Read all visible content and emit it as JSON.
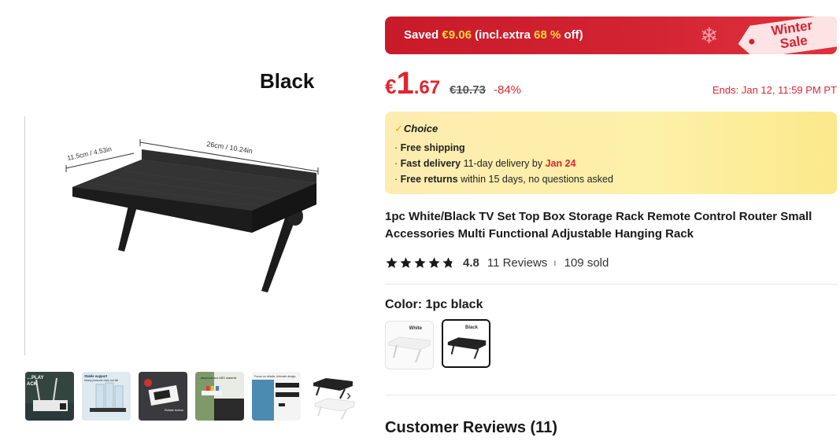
{
  "gallery": {
    "color_caption": "Black",
    "dimension_width": "26cm / 10.24in",
    "dimension_depth": "11.5cm / 4.53in",
    "next_icon": "chevron-right-icon",
    "next_glyph": "›",
    "thumbnails": [
      {
        "name": "thumb-display-rack",
        "lines": [
          "…PLAY",
          "ACK"
        ]
      },
      {
        "name": "thumb-bottles",
        "lines": [
          "Stable support",
          "Heavy pressure does not fall"
        ]
      },
      {
        "name": "thumb-router",
        "lines": [
          "Rotate button"
        ]
      },
      {
        "name": "thumb-scene",
        "lines": [
          "…aterproof and ABS material"
        ]
      },
      {
        "name": "thumb-install",
        "lines": [
          "Focus on details, Intimate design"
        ]
      },
      {
        "name": "thumb-variants",
        "lines": []
      }
    ]
  },
  "banner": {
    "saved_prefix": "Saved ",
    "saved_amount": "€9.06",
    "saved_middle": " (incl.extra ",
    "saved_percent": "68 %",
    "saved_suffix": " off)",
    "flake_icon": "snowflake-icon",
    "tag_line1": "Winter",
    "tag_line2": "Sale"
  },
  "price": {
    "currency": "€",
    "integer": "1",
    "decimal": ".67",
    "original": "€10.73",
    "discount": "-84%",
    "ends": "Ends: Jan 12, 11:59 PM PT"
  },
  "choice": {
    "check_glyph": "✓",
    "brand": "Choice",
    "bullet": "·",
    "free_shipping": "Free shipping",
    "fast_delivery_label": "Fast delivery",
    "fast_delivery_text": " 11-day delivery by ",
    "fast_delivery_date": "Jan 24",
    "free_returns_label": "Free returns",
    "free_returns_text": "  within 15 days, no questions asked"
  },
  "product": {
    "title": "1pc White/Black TV Set Top Box Storage Rack Remote Control Router Small Accessories Multi Functional Adjustable Hanging Rack",
    "rating": 4.8,
    "rating_label": "4.8",
    "reviews": "11 Reviews",
    "sep": "ı",
    "sold": "109 sold"
  },
  "color": {
    "label": "Color: 1pc black",
    "options": [
      {
        "name": "white",
        "caption": "White",
        "selected": false
      },
      {
        "name": "black",
        "caption": "Black",
        "selected": true
      }
    ]
  },
  "customer_reviews": {
    "heading": "Customer Reviews (11)"
  },
  "colors": {
    "accent_red": "#e0252f",
    "banner_red": "#d22333",
    "highlight_yellow": "#ffd83a",
    "choice_bg": "#fdf0a8"
  }
}
